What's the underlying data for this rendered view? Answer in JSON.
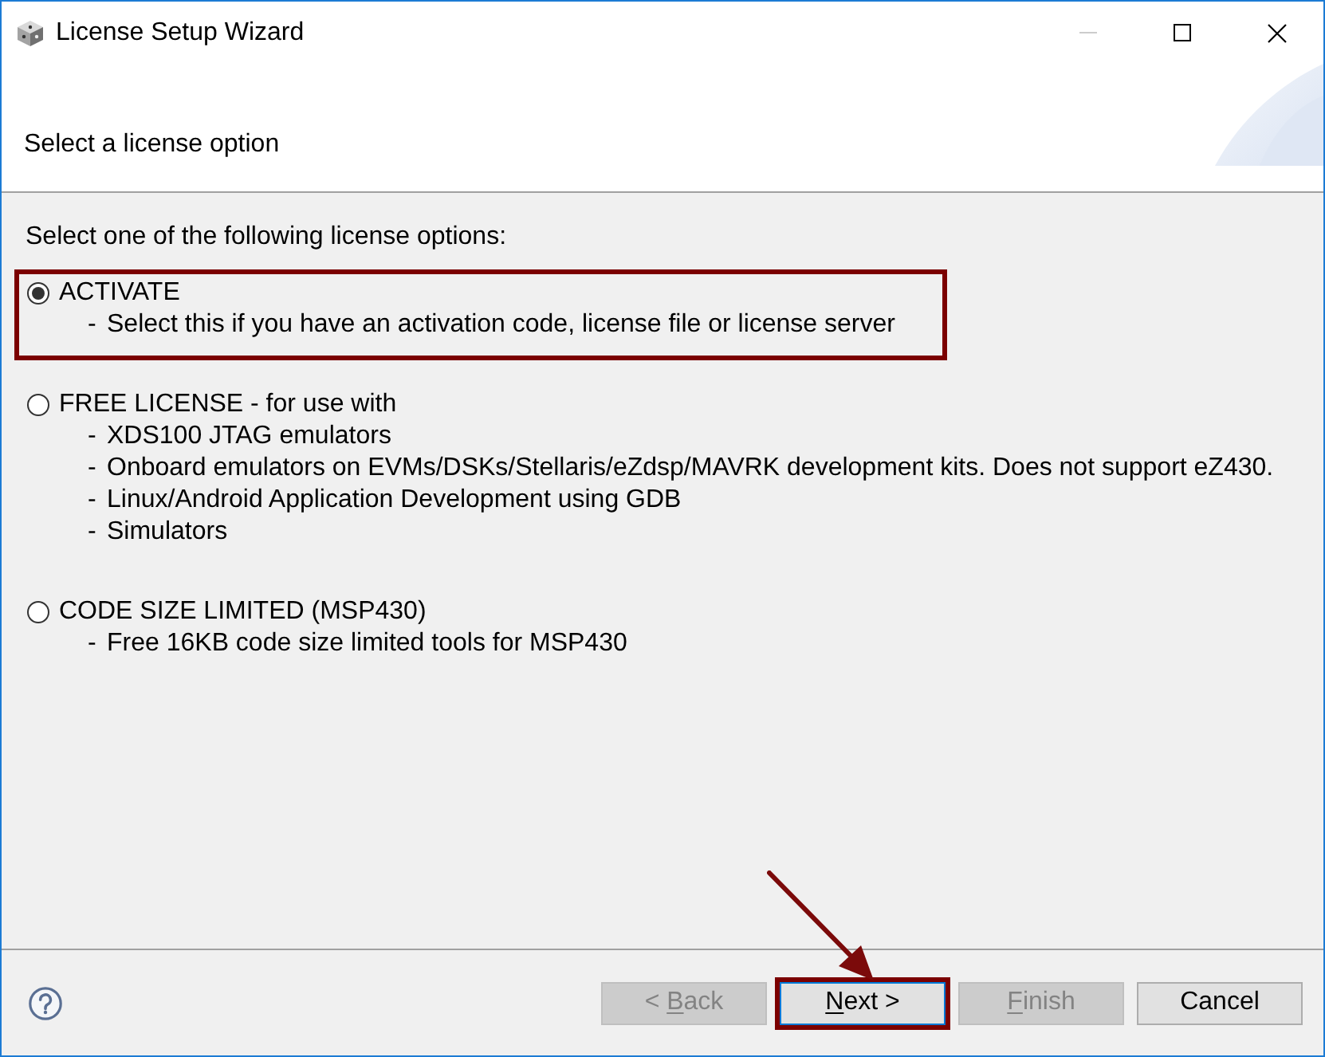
{
  "window": {
    "title": "License Setup Wizard",
    "controls": [
      {
        "kind": "minimize",
        "disabled": true
      },
      {
        "kind": "maximize",
        "disabled": false
      },
      {
        "kind": "close",
        "disabled": false
      }
    ]
  },
  "header": {
    "title": "Select a license option"
  },
  "prompt": "Select one of the following license options:",
  "options": [
    {
      "label": "ACTIVATE",
      "selected": true,
      "highlighted": true,
      "details": [
        {
          "marker": "-",
          "text": "Select this if you have an activation code, license file or license server"
        }
      ]
    },
    {
      "label": "FREE LICENSE - for use with",
      "selected": false,
      "highlighted": false,
      "details": [
        {
          "marker": "-",
          "text": "XDS100 JTAG emulators"
        },
        {
          "marker": "-",
          "text": "Onboard emulators on EVMs/DSKs/Stellaris/eZdsp/MAVRK development kits. Does not support eZ430."
        },
        {
          "marker": "-",
          "text": "Linux/Android Application Development using GDB"
        },
        {
          "marker": "-",
          "text": "Simulators"
        }
      ]
    },
    {
      "label": "CODE SIZE LIMITED (MSP430)",
      "selected": false,
      "highlighted": false,
      "details": [
        {
          "marker": "-",
          "text": "Free 16KB code size limited tools for MSP430"
        }
      ]
    }
  ],
  "buttons": [
    {
      "label": "< Back",
      "disabled": true,
      "default": false,
      "highlighted": false,
      "access_key_underlined": true
    },
    {
      "label": "Next >",
      "disabled": false,
      "default": true,
      "highlighted": true,
      "access_key_underlined": true
    },
    {
      "label": "Finish",
      "disabled": true,
      "default": false,
      "highlighted": false,
      "access_key_underlined": true
    },
    {
      "label": "Cancel",
      "disabled": false,
      "default": false,
      "highlighted": false,
      "access_key_underlined": false
    }
  ]
}
